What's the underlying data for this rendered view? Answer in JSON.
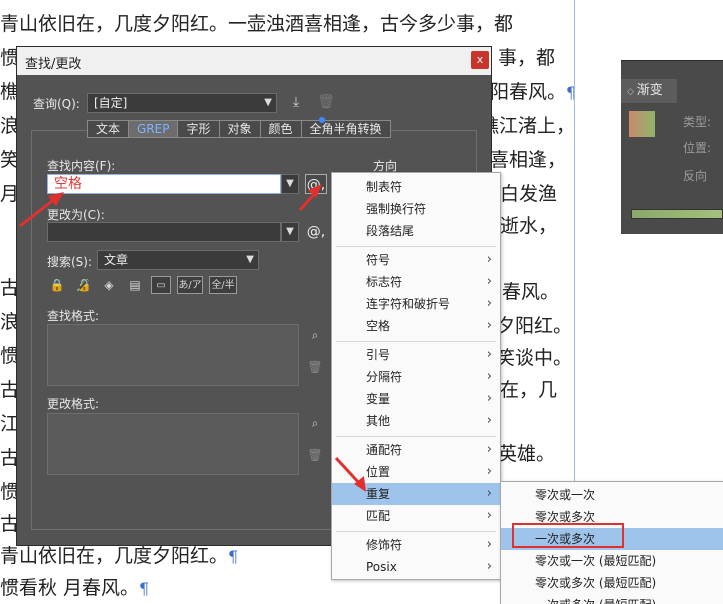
{
  "document": {
    "lines": [
      "青山依旧在，几度夕阳红。一壶浊酒喜相逢，古今多少事，都",
      "惯",
      "樵",
      "浪花",
      "笑",
      "月",
      "古",
      "浪",
      "惯",
      "古",
      "江",
      "古",
      "惯",
      "古",
      "青山依旧在，几度夕阳红。",
      "惯看秋 月春风。"
    ],
    "right_fragments": [
      "事，都",
      "阳春风。",
      "樵江渚上，",
      "喜相逢，",
      "白发渔",
      "逝水，",
      "春风。",
      "夕阳红。",
      "笑谈中。",
      "在，几",
      "英雄。"
    ],
    "pilcrow": "¶"
  },
  "gradient_panel": {
    "tab_label": "渐变",
    "type_label": "类型:",
    "position_label": "位置:",
    "reverse_label": "反向"
  },
  "dialog": {
    "title": "查找/更改",
    "close_label": "x",
    "query_label": "查询(Q):",
    "query_value": "[自定]",
    "tabs": [
      "文本",
      "GREP",
      "字形",
      "对象",
      "颜色",
      "全角半角转换"
    ],
    "find_label": "查找内容(F):",
    "find_value": "空格",
    "change_label": "更改为(C):",
    "change_value": "",
    "direction_label": "方向",
    "search_label": "搜索(S):",
    "search_value": "文章",
    "opt_kana": "あ/ア",
    "opt_width": "全/半",
    "find_format_label": "查找格式:",
    "change_format_label": "更改格式:",
    "at_symbol": "@,"
  },
  "menu": {
    "items": [
      {
        "label": "制表符",
        "sub": ""
      },
      {
        "label": "强制换行符",
        "sub": ""
      },
      {
        "label": "段落结尾",
        "sub": ""
      },
      {
        "label": "符号",
        "sub": "›"
      },
      {
        "label": "标志符",
        "sub": "›"
      },
      {
        "label": "连字符和破折号",
        "sub": "›"
      },
      {
        "label": "空格",
        "sub": "›"
      },
      {
        "label": "引号",
        "sub": "›"
      },
      {
        "label": "分隔符",
        "sub": "›"
      },
      {
        "label": "变量",
        "sub": "›"
      },
      {
        "label": "其他",
        "sub": "›"
      },
      {
        "label": "通配符",
        "sub": "›"
      },
      {
        "label": "位置",
        "sub": "›"
      },
      {
        "label": "重复",
        "sub": "›"
      },
      {
        "label": "匹配",
        "sub": "›"
      },
      {
        "label": "修饰符",
        "sub": "›"
      },
      {
        "label": "Posix",
        "sub": "›"
      }
    ]
  },
  "submenu": {
    "items": [
      "零次或一次",
      "零次或多次",
      "一次或多次",
      "零次或一次 (最短匹配)",
      "零次或多次 (最短匹配)",
      "一次或多次 (最短匹配)"
    ]
  },
  "colors": {
    "dialog_bg": "#535353",
    "highlight": "#9fc4ec",
    "annotation_red": "#e0312f",
    "active_tab_text": "#7fb2ff"
  }
}
